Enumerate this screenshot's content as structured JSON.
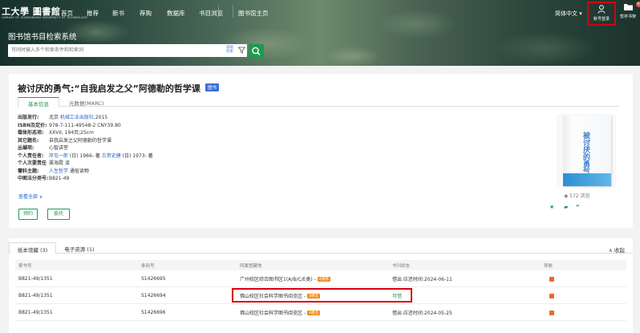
{
  "header": {
    "logo_text": "工大學 圖書館",
    "logo_sub": "LIBRARY OF GUANGDONG UNIVERSITY OF TECHNOLOGY",
    "nav": [
      "首页",
      "推荐",
      "新书",
      "荐购",
      "数据库",
      "书目浏览",
      "图书馆主页"
    ],
    "language": "简体中文 ▾",
    "login_label": "账号登录",
    "shelf_label": "暂存书架",
    "shelf_count": "0"
  },
  "system_title": "图书馆书目检索系统",
  "search": {
    "placeholder": "可同时输入多个检索条件和检索词",
    "advanced_label": "高级检索"
  },
  "book": {
    "title": "被讨厌的勇气:“自我启发之父”阿德勒的哲学课",
    "type_badge": "图书",
    "tabs": [
      "基本信息",
      "元数据(MARC)"
    ],
    "fields": [
      {
        "key": "出版发行:",
        "value": "北京 ",
        "link": "机械工业出版社",
        "after": ",2015"
      },
      {
        "key": "ISBN及定价:",
        "value": "978-7-111-49548-2 CNY39.80"
      },
      {
        "key": "载体形态项:",
        "value": "XXVII, 194页;25cm"
      },
      {
        "key": "其它题名:",
        "value": "自我启发之父阿德勒的哲学课"
      },
      {
        "key": "丛编项:",
        "value": "心智讲堂"
      },
      {
        "key": "个人责任者:",
        "value": "",
        "link": "岸见一郎",
        "after": " (日) 1966- 著 ",
        "link2": "古贺史健",
        "after2": " (日) 1973- 著"
      },
      {
        "key": "个人次要责任者:",
        "value": "渠海霞 译"
      },
      {
        "key": "学科主题:",
        "value": "",
        "link": "人生哲学",
        "after": " 通俗读物"
      },
      {
        "key": "中图法分类号:",
        "value": "B821-49"
      }
    ],
    "show_all": "查看全部 ∨",
    "reserve_button": "预约",
    "delegate_button": "委托",
    "views": "572 浏览",
    "cover_text": "被讨厌的勇气"
  },
  "holdings": {
    "tabs": [
      "纸本馆藏 (3)",
      "电子资源 (1)"
    ],
    "collapse_label": "∧ 收起",
    "columns": [
      "索书号",
      "条码号",
      "所属馆藏地",
      "书刊状态",
      "导航"
    ],
    "rows": [
      {
        "call": "B821-49/1351",
        "barcode": "S1426695",
        "location": "广州校区综合图书区1(A/B/C/E类) -",
        "loc_tag": "4楼南",
        "status": "借出 应还时间:2024-06-11"
      },
      {
        "call": "B821-49/1351",
        "barcode": "S1426694",
        "location": "佛山校区社会科学图书阅览区 -",
        "loc_tag": "4楼北",
        "status": "可借"
      },
      {
        "call": "B821-49/1351",
        "barcode": "S1426696",
        "location": "佛山校区社会科学图书阅览区 -",
        "loc_tag": "4楼北",
        "status": "借出 应还时间:2024-05-25"
      }
    ]
  },
  "colors": {
    "accent": "#1e9a50",
    "link": "#2563c9",
    "tag": "#f08c1a",
    "highlight": "#d8000f"
  }
}
